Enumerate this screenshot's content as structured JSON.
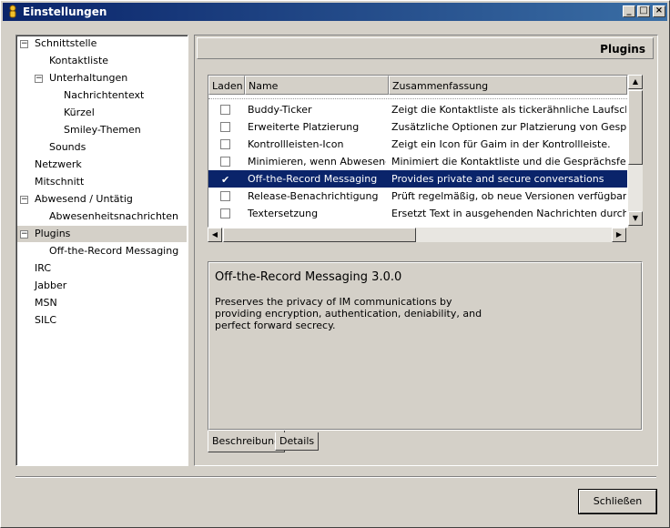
{
  "window": {
    "title": "Einstellungen",
    "controls": {
      "minimize": "_",
      "maximize": "□",
      "close": "×"
    }
  },
  "tree": {
    "items": [
      {
        "label": "Schnittstelle",
        "expander": "−"
      },
      {
        "label": "Kontaktliste"
      },
      {
        "label": "Unterhaltungen",
        "expander": "−"
      },
      {
        "label": "Nachrichtentext"
      },
      {
        "label": "Kürzel"
      },
      {
        "label": "Smiley-Themen"
      },
      {
        "label": "Sounds"
      },
      {
        "label": "Netzwerk"
      },
      {
        "label": "Mitschnitt"
      },
      {
        "label": "Abwesend / Untätig",
        "expander": "−"
      },
      {
        "label": "Abwesenheitsnachrichten"
      },
      {
        "label": "Plugins",
        "expander": "−",
        "selected": true
      },
      {
        "label": "Off-the-Record Messaging"
      },
      {
        "label": "IRC"
      },
      {
        "label": "Jabber"
      },
      {
        "label": "MSN"
      },
      {
        "label": "SILC"
      }
    ]
  },
  "panel": {
    "title": "Plugins",
    "columns": {
      "load": "Laden",
      "name": "Name",
      "summary": "Zusammenfassung"
    },
    "plugins": [
      {
        "name": "Buddy-Ticker",
        "summary": "Zeigt die Kontaktliste als tickerähnliche Laufschrift.",
        "loaded": false
      },
      {
        "name": "Erweiterte Platzierung",
        "summary": "Zusätzliche Optionen zur Platzierung von Gesprächen",
        "loaded": false
      },
      {
        "name": "Kontrollleisten-Icon",
        "summary": "Zeigt ein Icon für Gaim in der Kontrollleiste.",
        "loaded": false
      },
      {
        "name": "Minimieren, wenn Abwesend",
        "summary": "Minimiert die Kontaktliste und die Gesprächsfenster, w",
        "loaded": false
      },
      {
        "name": "Off-the-Record Messaging",
        "summary": "Provides private and secure conversations",
        "loaded": true,
        "selected": true
      },
      {
        "name": "Release-Benachrichtigung",
        "summary": "Prüft regelmäßig, ob neue Versionen verfügbar sind.",
        "loaded": false
      },
      {
        "name": "Textersetzung",
        "summary": "Ersetzt Text in ausgehenden Nachrichten durch benu",
        "loaded": false
      }
    ],
    "description": {
      "title": "Off-the-Record Messaging 3.0.0",
      "text": "Preserves the privacy of IM communications by providing encryption, authentication, deniability, and perfect forward secrecy."
    },
    "tabs": {
      "description": "Beschreibung",
      "details": "Details"
    }
  },
  "buttons": {
    "close": "Schließen"
  },
  "colors": {
    "selection": "#0a246a",
    "face": "#d4d0c8"
  }
}
